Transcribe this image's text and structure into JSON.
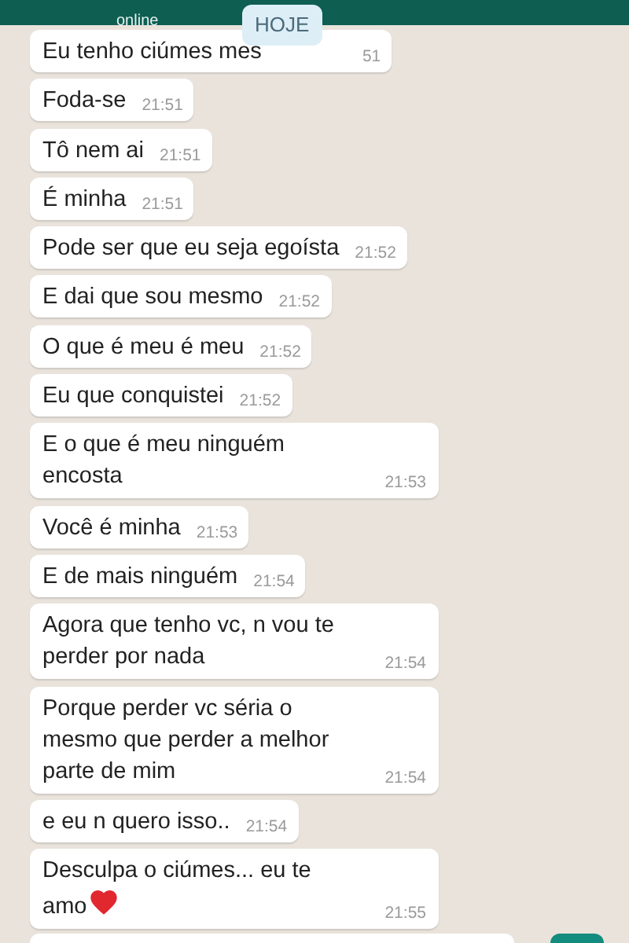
{
  "header": {
    "status": "online"
  },
  "date_badge": "HOJE",
  "messages": [
    {
      "text": "Eu tenho ciúmes mes",
      "time": "51"
    },
    {
      "text": "Foda-se",
      "time": "21:51"
    },
    {
      "text": "Tô nem ai",
      "time": "21:51"
    },
    {
      "text": "É minha",
      "time": "21:51"
    },
    {
      "text": "Pode ser que eu seja egoísta",
      "time": "21:52"
    },
    {
      "text": "E dai que sou mesmo",
      "time": "21:52"
    },
    {
      "text": "O que é meu é meu",
      "time": "21:52"
    },
    {
      "text": "Eu que conquistei",
      "time": "21:52"
    },
    {
      "text": "E o que é meu ninguém encosta",
      "time": "21:53"
    },
    {
      "text": "Você é minha",
      "time": "21:53"
    },
    {
      "text": "E de mais ninguém",
      "time": "21:54"
    },
    {
      "text": "Agora que tenho vc, n vou te perder por nada",
      "time": "21:54"
    },
    {
      "text": "Porque perder vc séria o mesmo que perder a melhor parte de mim",
      "time": "21:54"
    },
    {
      "text": "e eu n quero isso..",
      "time": "21:54"
    },
    {
      "text": "Desculpa o ciúmes... eu te amo",
      "time": "21:55",
      "heart": true
    }
  ]
}
